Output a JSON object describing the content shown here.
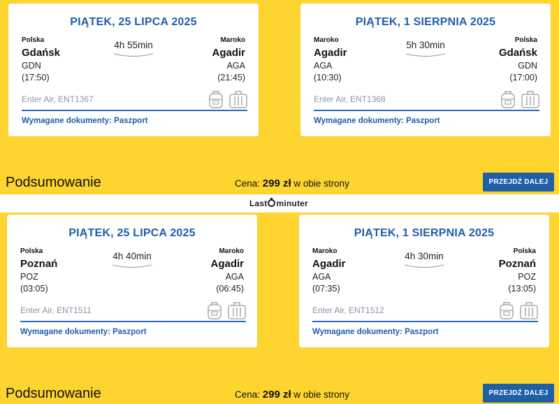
{
  "offers": [
    {
      "outbound": {
        "date": "PIĄTEK, 25 LIPCA 2025",
        "from_country": "Polska",
        "from_city": "Gdańsk",
        "from_code": "GDN",
        "from_time": "(17:50)",
        "duration": "4h 55min",
        "to_country": "Maroko",
        "to_city": "Agadir",
        "to_code": "AGA",
        "to_time": "(21:45)",
        "flight": "Enter Air, ENT1367",
        "docs": "Wymagane dokumenty: Paszport"
      },
      "inbound": {
        "date": "PIĄTEK, 1 SIERPNIA 2025",
        "from_country": "Maroko",
        "from_city": "Agadir",
        "from_code": "AGA",
        "from_time": "(10:30)",
        "duration": "5h 30min",
        "to_country": "Polska",
        "to_city": "Gdańsk",
        "to_code": "GDN",
        "to_time": "(17:00)",
        "flight": "Enter Air, ENT1368",
        "docs": "Wymagane dokumenty: Paszport"
      },
      "summary": "Podsumowanie",
      "price_prefix": "Cena: ",
      "price_value": "299 zł",
      "price_suffix": " w obie strony",
      "button": "PRZEJDŹ DALEJ"
    },
    {
      "outbound": {
        "date": "PIĄTEK, 25 LIPCA 2025",
        "from_country": "Polska",
        "from_city": "Poznań",
        "from_code": "POZ",
        "from_time": "(03:05)",
        "duration": "4h 40min",
        "to_country": "Maroko",
        "to_city": "Agadir",
        "to_code": "AGA",
        "to_time": "(06:45)",
        "flight": "Enter Air, ENT1511",
        "docs": "Wymagane dokumenty: Paszport"
      },
      "inbound": {
        "date": "PIĄTEK, 1 SIERPNIA 2025",
        "from_country": "Maroko",
        "from_city": "Agadir",
        "from_code": "AGA",
        "from_time": "(07:35)",
        "duration": "4h 30min",
        "to_country": "Polska",
        "to_city": "Poznań",
        "to_code": "POZ",
        "to_time": "(13:05)",
        "flight": "Enter Air, ENT1512",
        "docs": "Wymagane dokumenty: Paszport"
      },
      "summary": "Podsumowanie",
      "price_prefix": "Cena: ",
      "price_value": "299 zł",
      "price_suffix": " w obie strony",
      "button": "PRZEJDŹ DALEJ"
    }
  ],
  "logo": {
    "left": "Last",
    "right": "minuter"
  },
  "colors": {
    "background": "#fed42e",
    "accent": "#1f5fa8",
    "card": "#ffffff"
  },
  "icons": [
    "backpack-icon",
    "suitcase-icon"
  ]
}
